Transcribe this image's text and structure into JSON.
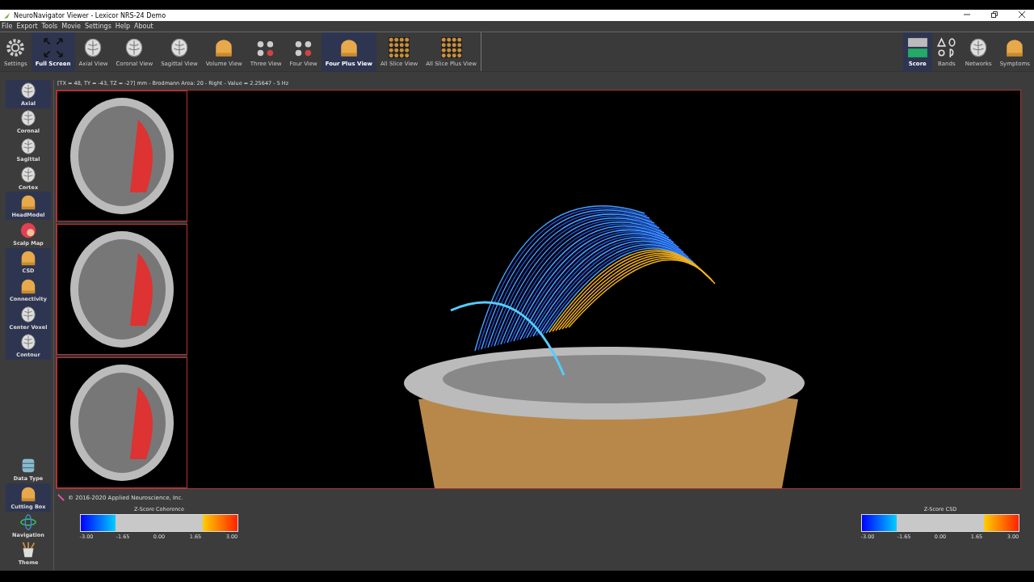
{
  "window": {
    "title": "NeuroNavigator Viewer - Lexicor NRS-24 Demo"
  },
  "menu": [
    "File",
    "Export",
    "Tools",
    "Movie",
    "Settings",
    "Help",
    "About"
  ],
  "toolbar": [
    {
      "label": "Settings",
      "kind": "gear",
      "selected": false
    },
    {
      "label": "Full Screen",
      "kind": "expand",
      "selected": true
    },
    {
      "label": "Axial View",
      "kind": "brain",
      "selected": false
    },
    {
      "label": "Coronal View",
      "kind": "brain",
      "selected": false
    },
    {
      "label": "Sagittal View",
      "kind": "brain",
      "selected": false
    },
    {
      "label": "Volume View",
      "kind": "head",
      "selected": false
    },
    {
      "label": "Three View",
      "kind": "multi",
      "selected": false
    },
    {
      "label": "Four View",
      "kind": "multi",
      "selected": false
    },
    {
      "label": "Four Plus View",
      "kind": "head",
      "selected": true
    },
    {
      "label": "All Slice View",
      "kind": "grid",
      "selected": false
    },
    {
      "label": "All Slice Plus View",
      "kind": "grid",
      "selected": false
    }
  ],
  "toolbar_right": [
    {
      "label": "Score",
      "kind": "score",
      "selected": true
    },
    {
      "label": "Bands",
      "kind": "greek",
      "selected": false
    },
    {
      "label": "Networks",
      "kind": "brain",
      "selected": false
    },
    {
      "label": "Symptoms",
      "kind": "head",
      "selected": false
    }
  ],
  "sidebar_top": [
    {
      "label": "Axial",
      "kind": "brain",
      "on": true
    },
    {
      "label": "Coronal",
      "kind": "brain",
      "on": false
    },
    {
      "label": "Sagittal",
      "kind": "brain",
      "on": false
    },
    {
      "label": "Cortex",
      "kind": "brain",
      "on": false
    },
    {
      "label": "HeadModel",
      "kind": "head",
      "on": true
    },
    {
      "label": "Scalp Map",
      "kind": "scalp",
      "on": false
    },
    {
      "label": "CSD",
      "kind": "head",
      "on": true
    },
    {
      "label": "Connectivity",
      "kind": "head",
      "on": true
    },
    {
      "label": "Center Voxel",
      "kind": "brain",
      "on": true
    },
    {
      "label": "Contour",
      "kind": "brain",
      "on": true
    }
  ],
  "sidebar_bottom": [
    {
      "label": "Data Type",
      "kind": "database",
      "on": false
    },
    {
      "label": "Cutting Box",
      "kind": "head",
      "on": true
    },
    {
      "label": "Navigation",
      "kind": "orbit",
      "on": false
    },
    {
      "label": "Theme",
      "kind": "brush",
      "on": false
    }
  ],
  "info_line": "[TX = 48, TY = -43, TZ = -27] mm - Brodmann Area: 20 - Right - Value = 2.25647 - 5 Hz",
  "copyright": "© 2016-2020 Applied Neuroscience, Inc.",
  "legends": [
    {
      "title": "Z-Score Coherence",
      "ticks": [
        "-3.00",
        "-1.65",
        "0.00",
        "1.65",
        "3.00"
      ]
    },
    {
      "title": "Z-Score CSD",
      "ticks": [
        "-3.00",
        "-1.65",
        "0.00",
        "1.65",
        "3.00"
      ]
    }
  ]
}
